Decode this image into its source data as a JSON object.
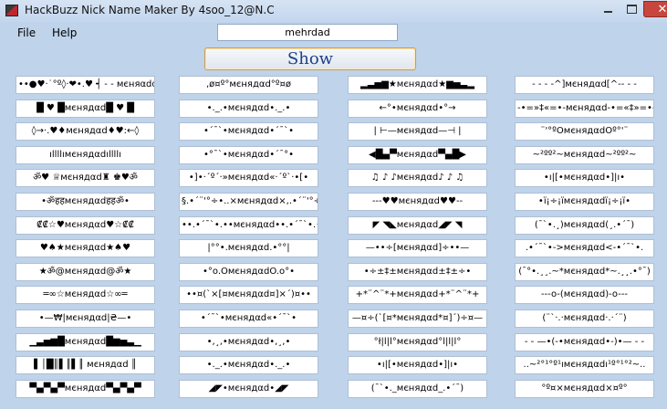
{
  "window": {
    "title": "HackBuzz Nick Name Maker   By 4soo_12@N.C"
  },
  "menu": [
    {
      "label": "File"
    },
    {
      "label": "Help"
    }
  ],
  "input": {
    "value": "mehrdad"
  },
  "show_button": {
    "label": "Show"
  },
  "columns": [
    {
      "items": [
        "••●♥·˙°º◊·❤•.♥ ┥ - - мєняαdα",
        "█ ♥ █мєнядαd█ ♥ █",
        "◊→·.♥♦мєнядαd♦♥:←◊",
        "ıllllıмєнядαdıllllı",
        "ॐ♥ ♕мєнядαd♜ ♚♥ॐ",
        "•ॐहहмєнядαdहहॐ•",
        "₡₡☆♥мєнядαd♥☆₡₡",
        "♥♠★мєнядαd★♠♥",
        "★ॐ@мєнядαd@ॐ★",
        "═∞☆мєнядαd☆∞═",
        "•—₩|мєнядαd|₴—•",
        "▁▃▅▆█мєнядαd█▆▅▃▁",
        "▌│█║▌║▌║ мєнядαd ║",
        "▀▄▀▄▀мєнядαd▀▄▀▄▀"
      ]
    },
    {
      "items": [
        ",ø¤º°мєнядαd°º¤ø",
        "•._.•мєнядαd•._.•",
        "•´¯`•мєнядαd•´¯`•",
        "•°¯`•мєнядαd•´¯°•",
        "•]•·´º´·»мєнядαd«·´º`·•[•",
        "§.•´¨'°÷•..×мєнядαd×,.•´¨'°÷•.",
        "••.•´¯`•.••мєнядαd••.•´¯`•.••",
        "|°°•.мєнядαd.•°°|",
        "•°o.OмєнядαdO.o°•",
        "••¤(`×[¤мєнядαd¤]×´)¤••",
        "•´¯`•мєнядαd«•´¯`•",
        "•,¸,•мєнядαd•,¸,•",
        "•._.•мєнядαd•._.•",
        "◢◤•мєнядαd•◢◤"
      ]
    },
    {
      "items": [
        "▂▃▅▆★мєнядαd★▆▅▃▂",
        "←°•мєнядαd•°→",
        "| ⊢—мєнядαd—⊣ |",
        "◀█▄▀мєнядαd▀▄█▶",
        "♫ ♪ ♪мєнядαd♪ ♪ ♫",
        "---♥♥мєнядαd♥♥--",
        "◤ ◥◣мєнядαd◢◤ ◥",
        "—••÷[мєнядαd]÷••—",
        "•÷±‡±мєнядαd±‡±÷•",
        "+*¨^¨*+мєнядαd+*¨^¨*+",
        "—¤÷(`[¤*мєнядαd*¤]´)÷¤—",
        "°ł|l|l°мєнядαd°l|l|l°",
        "•ı|[•мєнядαd•]|ı•",
        "(¯`•._мєнядαd_.•´¯)"
      ]
    },
    {
      "items": [
        "- - - -^]мєнядαd[^-- - -",
        "-•=»‡«=•-мєнядαd-•=«‡»=•-",
        "¨'°ºOмєнядαdOº°'¨",
        "~²ºº²~мєнядαd~²ºº²~",
        "•ı|[•мєнядαd•]|ı•",
        "•ï¡÷¡ïмєнядαdï¡÷¡ï•",
        "(¯`•.¸)мєнядαd(¸.•´¯)",
        ".•´¯`•->мєнядαd<-•´¯`•.",
        "(¯°•.¸¸.~*мєнядαd*~.¸¸.•°¯)",
        "---o-(мєнядαd)-o---",
        "(¨`·.·мєнядαd·.·´¨)",
        "- - —•(-•мєнядαd•-)•— - -",
        "..~²°¹°º¹ıмєнядαdı¹º°¹°²~..",
        "°º¤×мєнядαd×¤º°"
      ]
    }
  ]
}
